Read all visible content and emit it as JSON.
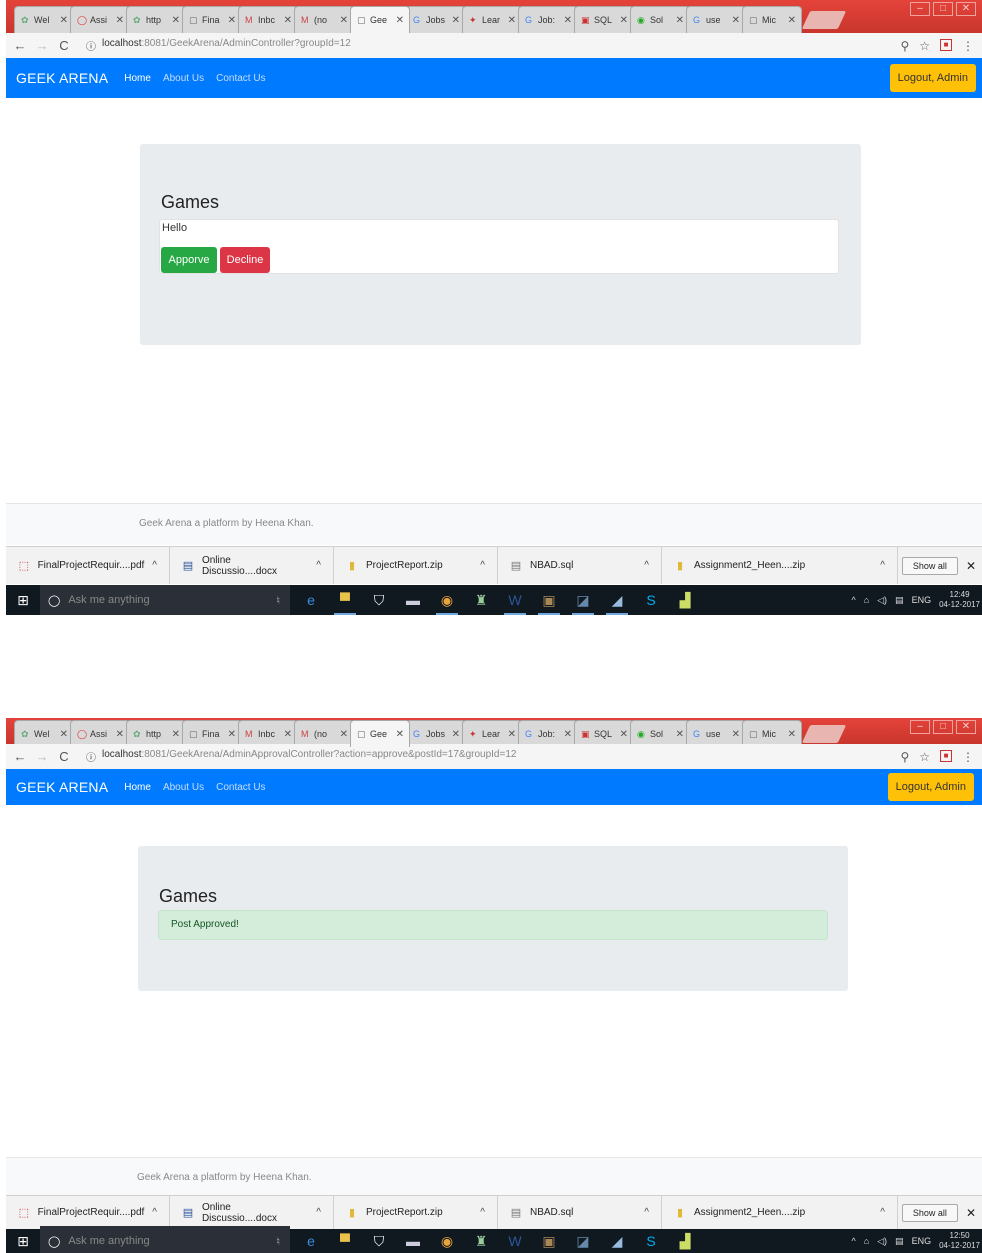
{
  "tabs": [
    {
      "label": "Wel",
      "icon": "globe"
    },
    {
      "label": "Assi",
      "icon": "opera"
    },
    {
      "label": "http",
      "icon": "globe"
    },
    {
      "label": "Fina",
      "icon": "page"
    },
    {
      "label": "Inbc",
      "icon": "gmail"
    },
    {
      "label": "(no",
      "icon": "gmail"
    },
    {
      "label": "Gee",
      "icon": "page"
    },
    {
      "label": "Jobs",
      "icon": "google"
    },
    {
      "label": "Lear",
      "icon": "cw"
    },
    {
      "label": "Job:",
      "icon": "google"
    },
    {
      "label": "SQL",
      "icon": "sql"
    },
    {
      "label": "Sol",
      "icon": "sol"
    },
    {
      "label": "use",
      "icon": "google"
    },
    {
      "label": "Mic",
      "icon": "page"
    }
  ],
  "navbar": {
    "brand": "GEEK ARENA",
    "links": [
      "Home",
      "About Us",
      "Contact Us"
    ],
    "logout": "Logout, Admin"
  },
  "screen1": {
    "url_host": "localhost",
    "url_path": ":8081/GeekArena/AdminController?groupId=12",
    "card_title": "Games",
    "post_text": "Hello",
    "approve_label": "Apporve",
    "decline_label": "Decline",
    "clock_time": "12:49",
    "clock_date": "04-12-2017"
  },
  "screen2": {
    "url_host": "localhost",
    "url_path": ":8081/GeekArena/AdminApprovalController?action=approve&postId=17&groupId=12",
    "card_title": "Games",
    "alert_text": "Post Approved!",
    "clock_time": "12:50",
    "clock_date": "04-12-2017"
  },
  "footer": {
    "text": "Geek Arena a platform by Heena Khan."
  },
  "downloads": [
    {
      "name": "FinalProjectRequir....pdf",
      "icon": "pdf"
    },
    {
      "name": "Online Discussio....docx",
      "icon": "docx"
    },
    {
      "name": "ProjectReport.zip",
      "icon": "zip"
    },
    {
      "name": "NBAD.sql",
      "icon": "file"
    },
    {
      "name": "Assignment2_Heen....zip",
      "icon": "zip"
    }
  ],
  "show_all": "Show all",
  "taskbar": {
    "search_placeholder": "Ask me anything",
    "lang": "ENG"
  }
}
